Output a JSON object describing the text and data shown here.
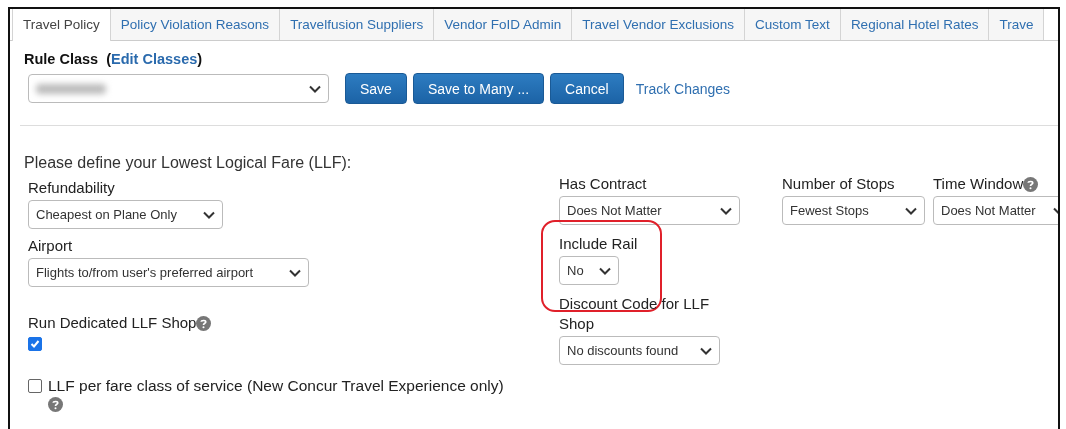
{
  "tabs": [
    {
      "label": "Travel Policy",
      "selected": true
    },
    {
      "label": "Policy Violation Reasons",
      "selected": false
    },
    {
      "label": "Travelfusion Suppliers",
      "selected": false
    },
    {
      "label": "Vendor FoID Admin",
      "selected": false
    },
    {
      "label": "Travel Vendor Exclusions",
      "selected": false
    },
    {
      "label": "Custom Text",
      "selected": false
    },
    {
      "label": "Regional Hotel Rates",
      "selected": false
    },
    {
      "label": "Trave",
      "selected": false
    }
  ],
  "rule_class": {
    "label": "Rule Class",
    "prefix": "(",
    "link": "Edit Classes",
    "suffix": ")"
  },
  "buttons": [
    "Save",
    "Save to Many ...",
    "Cancel"
  ],
  "track_link": "Track Changes",
  "intro": "Please define your Lowest Logical Fare (LLF):",
  "left_fields": [
    {
      "kind": "select",
      "label": "Refundability",
      "value": "Cheapest on Plane Only",
      "help": false
    },
    {
      "kind": "select",
      "label": "Airport",
      "value": "Flights to/from user's preferred airport",
      "help": false
    },
    {
      "kind": "checkbox_below",
      "label": "Run Dedicated LLF Shop",
      "checked": true,
      "help": true
    },
    {
      "kind": "checkbox_inline",
      "label": "LLF per fare class of service (New Concur Travel Experience only)",
      "checked": false,
      "help": true
    }
  ],
  "top_fields": [
    {
      "label": "Has Contract",
      "value": "Does Not Matter",
      "help": false
    },
    {
      "label": "Number of Stops",
      "value": "Fewest Stops",
      "help": false
    },
    {
      "label": "Time Window",
      "value": "Does Not Matter",
      "help": true
    }
  ],
  "lower_fields": [
    {
      "label": "Include Rail",
      "value": "No",
      "highlighted": true
    },
    {
      "label": "Discount Code for LLF Shop",
      "value": "No discounts found",
      "highlighted": false
    }
  ]
}
